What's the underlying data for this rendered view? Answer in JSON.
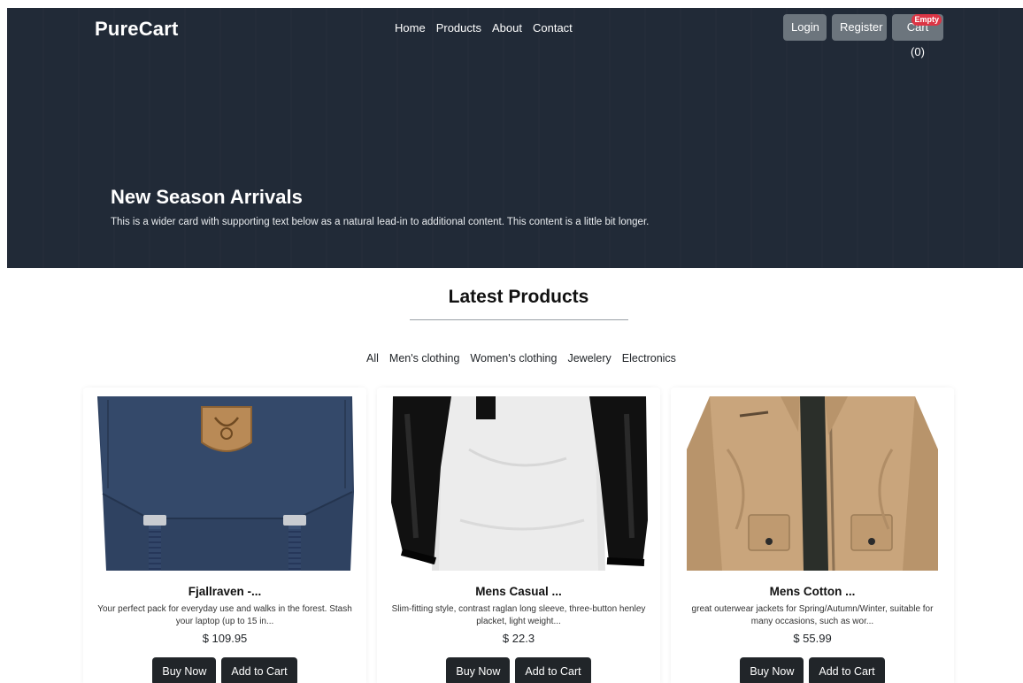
{
  "navbar": {
    "brand": "PureCart",
    "links": [
      "Home",
      "Products",
      "About",
      "Contact"
    ],
    "login_label": "Login",
    "register_label": "Register",
    "cart_label": "Cart (0)",
    "cart_badge": "Empty"
  },
  "hero": {
    "title": "New Season Arrivals",
    "text": "This is a wider card with supporting text below as a natural lead-in to additional content. This content is a little bit longer."
  },
  "products_section": {
    "title": "Latest Products",
    "filters": [
      "All",
      "Men's clothing",
      "Women's clothing",
      "Jewelery",
      "Electronics"
    ]
  },
  "products": [
    {
      "title": "Fjallraven -...",
      "description": "Your perfect pack for everyday use and walks in the forest. Stash your laptop (up to 15 in...",
      "price": "$ 109.95",
      "buy_label": "Buy Now",
      "cart_label": "Add to Cart",
      "image": "backpack"
    },
    {
      "title": "Mens Casual ...",
      "description": "Slim-fitting style, contrast raglan long sleeve, three-button henley placket, light weight...",
      "price": "$ 22.3",
      "buy_label": "Buy Now",
      "cart_label": "Add to Cart",
      "image": "raglan-shirt"
    },
    {
      "title": "Mens Cotton ...",
      "description": "great outerwear jackets for Spring/Autumn/Winter, suitable for many occasions, such as wor...",
      "price": "$ 55.99",
      "buy_label": "Buy Now",
      "cart_label": "Add to Cart",
      "image": "cotton-jacket"
    }
  ],
  "colors": {
    "hero_bg": "#212a37",
    "button_secondary": "#6c757d",
    "button_dark": "#212529",
    "badge_danger": "#dc3545"
  }
}
